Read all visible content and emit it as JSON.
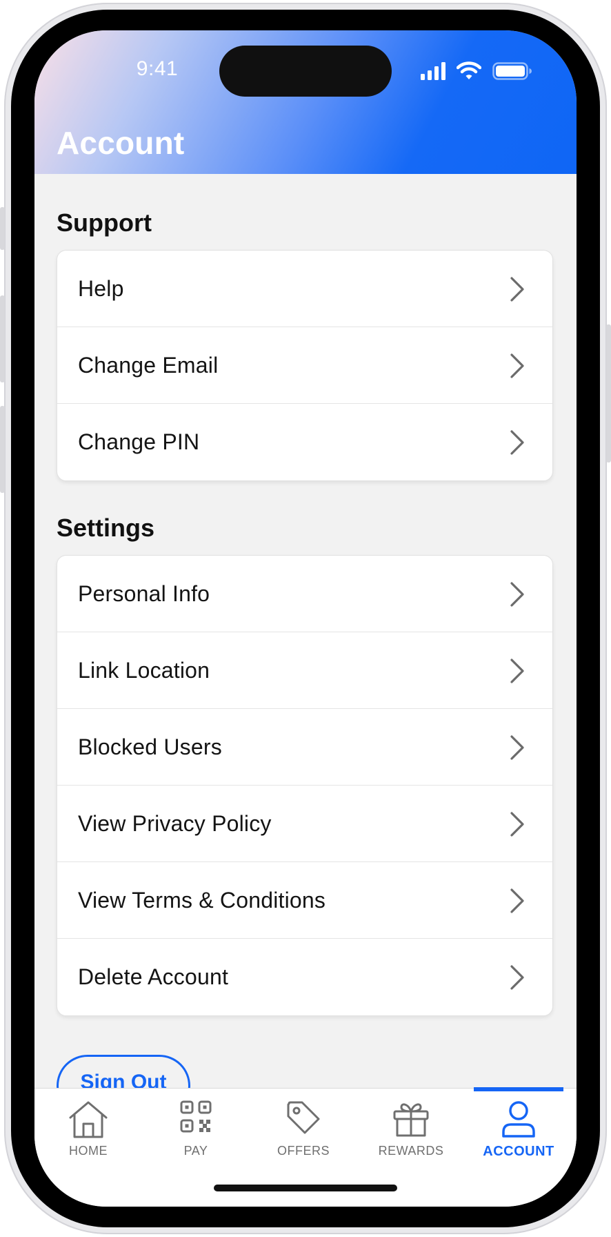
{
  "status_bar": {
    "time": "9:41"
  },
  "header": {
    "title": "Account"
  },
  "support": {
    "title": "Support",
    "items": [
      {
        "label": "Help"
      },
      {
        "label": "Change Email"
      },
      {
        "label": "Change PIN"
      }
    ]
  },
  "settings": {
    "title": "Settings",
    "items": [
      {
        "label": "Personal Info"
      },
      {
        "label": "Link Location"
      },
      {
        "label": "Blocked Users"
      },
      {
        "label": "View Privacy Policy"
      },
      {
        "label": "View Terms & Conditions"
      },
      {
        "label": "Delete Account"
      }
    ]
  },
  "sign_out": {
    "label": "Sign Out"
  },
  "tabbar": {
    "active": "ACCOUNT",
    "tabs": [
      {
        "label": "HOME",
        "icon": "home-icon"
      },
      {
        "label": "PAY",
        "icon": "qr-code-icon"
      },
      {
        "label": "OFFERS",
        "icon": "tag-icon"
      },
      {
        "label": "REWARDS",
        "icon": "gift-icon"
      },
      {
        "label": "ACCOUNT",
        "icon": "user-icon"
      }
    ]
  },
  "colors": {
    "accent": "#1565f5",
    "header_gradient_start": "#f9dfe6",
    "header_gradient_end": "#0f66f5",
    "background": "#f2f2f2"
  }
}
